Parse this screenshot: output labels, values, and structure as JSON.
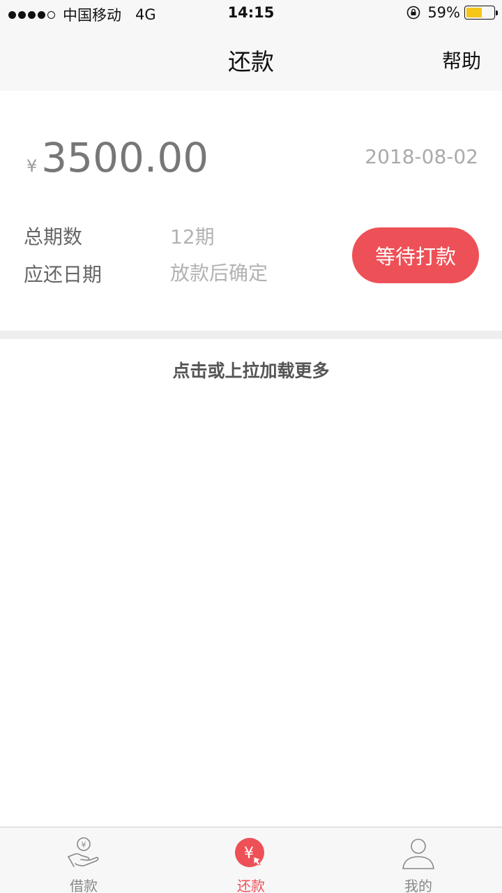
{
  "status_bar": {
    "carrier": "中国移动",
    "network": "4G",
    "time": "14:15",
    "battery_percent": "59%",
    "battery_level": 0.59
  },
  "nav": {
    "title": "还款",
    "help": "帮助"
  },
  "loan": {
    "currency_symbol": "¥",
    "amount": "3500.00",
    "date": "2018-08-02",
    "periods_label": "总期数",
    "periods_value": "12期",
    "due_label": "应还日期",
    "due_value": "放款后确定",
    "status_button": "等待打款"
  },
  "load_more": "点击或上拉加载更多",
  "tabs": [
    {
      "label": "借款",
      "icon": "loan-hand-icon",
      "active": false
    },
    {
      "label": "还款",
      "icon": "repay-yen-icon",
      "active": true
    },
    {
      "label": "我的",
      "icon": "user-profile-icon",
      "active": false
    }
  ],
  "colors": {
    "accent": "#ee5057",
    "battery": "#f5c518"
  }
}
